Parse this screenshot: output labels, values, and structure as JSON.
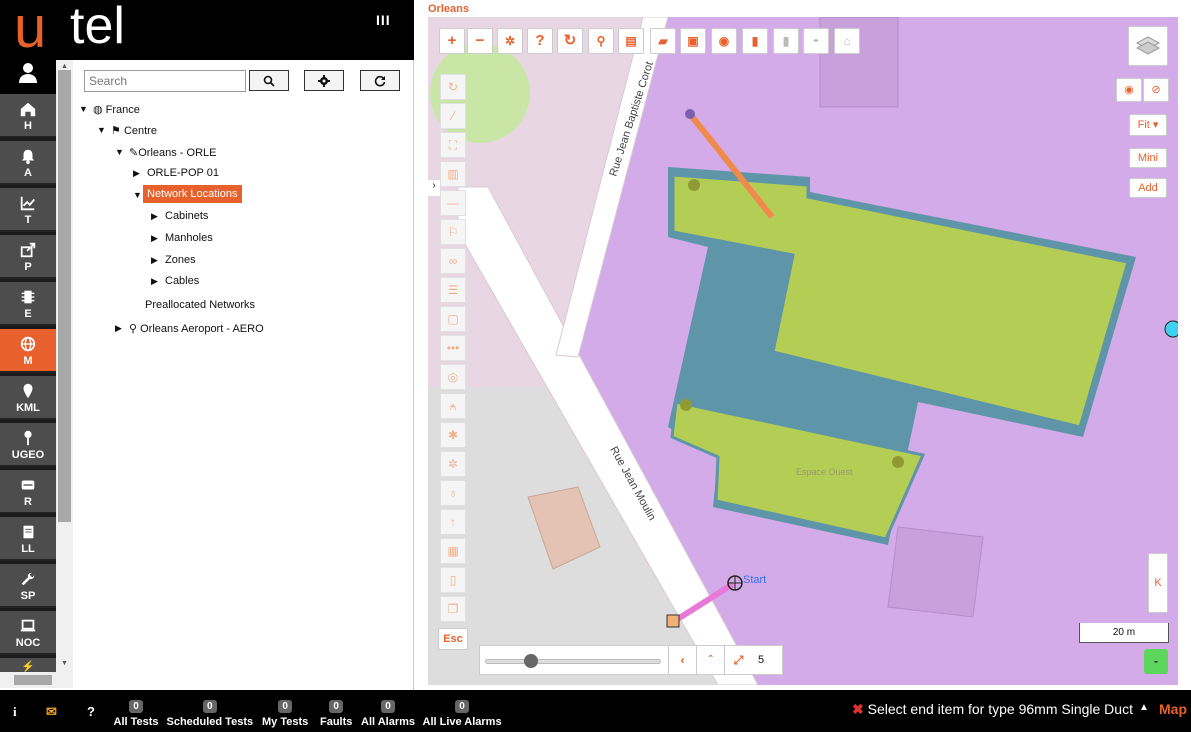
{
  "app": {
    "logo_u": "u",
    "logo_tel": "tel",
    "menu_icon": "menu-bars-icon",
    "menu_label": "III"
  },
  "rail": [
    {
      "label": "H",
      "icon": "home-icon"
    },
    {
      "label": "A",
      "icon": "bell-icon"
    },
    {
      "label": "T",
      "icon": "chart-icon"
    },
    {
      "label": "P",
      "icon": "share-icon"
    },
    {
      "label": "E",
      "icon": "chip-icon"
    },
    {
      "label": "M",
      "icon": "globe-icon",
      "active": true
    },
    {
      "label": "KML",
      "icon": "pin-icon"
    },
    {
      "label": "UGEO",
      "icon": "pushpin-icon"
    },
    {
      "label": "R",
      "icon": "router-icon"
    },
    {
      "label": "LL",
      "icon": "book-icon"
    },
    {
      "label": "SP",
      "icon": "wrench-icon"
    },
    {
      "label": "NOC",
      "icon": "laptop-icon"
    }
  ],
  "tree": {
    "search_placeholder": "Search",
    "nodes": {
      "france": "France",
      "centre": "Centre",
      "orleans": "Orleans - ORLE",
      "pop": "ORLE-POP 01",
      "network": "Network Locations",
      "cabinets": "Cabinets",
      "manholes": "Manholes",
      "zones": "Zones",
      "cables": "Cables",
      "prealloc": "Preallocated Networks",
      "aero": "Orleans Aeroport - AERO"
    }
  },
  "map": {
    "title": "Orleans",
    "street1": "Rue Jean Baptiste Corot",
    "street2": "Rue Jean Moulin",
    "start_label": "Start",
    "building_label": "Espace Ouest",
    "right_buttons": {
      "fit": "Fit",
      "mini": "Mini",
      "add": "Add",
      "k": "K",
      "minus": "-"
    },
    "esc": "Esc",
    "scale": "20 m",
    "zoom_level": "5",
    "slider_fraction": 0.2
  },
  "bottom": {
    "counters": [
      {
        "label": "All Tests",
        "count": "0"
      },
      {
        "label": "Scheduled Tests",
        "count": "0"
      },
      {
        "label": "My Tests",
        "count": "0"
      },
      {
        "label": "Faults",
        "count": "0"
      },
      {
        "label": "All Alarms",
        "count": "0"
      },
      {
        "label": "All Live Alarms",
        "count": "0"
      }
    ],
    "info_icon": "i",
    "help_icon": "?",
    "status": "Select end item for type 96mm Single Duct",
    "mode": "Map"
  },
  "colors": {
    "accent": "#e8612c",
    "rail": "#4d4d4d",
    "building": "#b3cd55",
    "zone": "#d4aee8"
  }
}
